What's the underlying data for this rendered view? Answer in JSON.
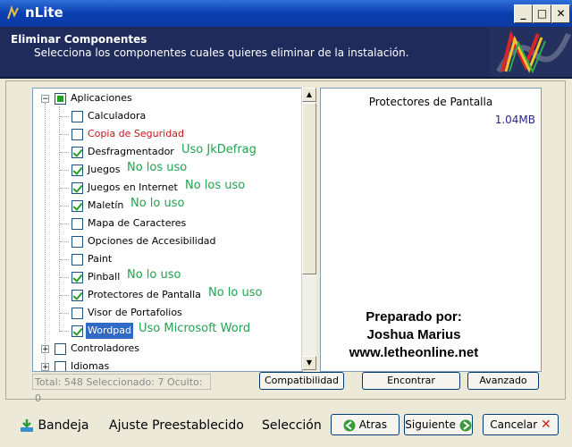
{
  "window": {
    "title": "nLite"
  },
  "header": {
    "title": "Eliminar Componentes",
    "subtitle": "Selecciona los componentes cuales quieres eliminar de la instalación."
  },
  "tree": {
    "root": {
      "label": "Aplicaciones",
      "state": "partial"
    },
    "items": [
      {
        "label": "Calculadora",
        "checked": false,
        "color": "#000000",
        "note": ""
      },
      {
        "label": "Copia de Seguridad",
        "checked": false,
        "color": "#c4161c",
        "note": ""
      },
      {
        "label": "Desfragmentador",
        "checked": true,
        "color": "#000000",
        "note": "Uso JkDefrag"
      },
      {
        "label": "Juegos",
        "checked": true,
        "color": "#000000",
        "note": "No los uso"
      },
      {
        "label": "Juegos en Internet",
        "checked": true,
        "color": "#000000",
        "note": "No los uso"
      },
      {
        "label": "Maletín",
        "checked": true,
        "color": "#000000",
        "note": "No lo uso"
      },
      {
        "label": "Mapa de Caracteres",
        "checked": false,
        "color": "#000000",
        "note": ""
      },
      {
        "label": "Opciones de Accesibilidad",
        "checked": false,
        "color": "#000000",
        "note": ""
      },
      {
        "label": "Paint",
        "checked": false,
        "color": "#000000",
        "note": ""
      },
      {
        "label": "Pinball",
        "checked": true,
        "color": "#000000",
        "note": "No lo uso"
      },
      {
        "label": "Protectores de Pantalla",
        "checked": true,
        "color": "#000000",
        "note": "No lo uso"
      },
      {
        "label": "Visor de Portafolios",
        "checked": false,
        "color": "#000000",
        "note": ""
      },
      {
        "label": "Wordpad",
        "checked": true,
        "color": "#000000",
        "note": "Uso Microsoft Word",
        "selected": true
      }
    ],
    "groups": [
      {
        "label": "Controladores"
      },
      {
        "label": "Idiomas"
      }
    ]
  },
  "info": {
    "title": "Protectores de Pantalla",
    "size": "1.04MB",
    "prepared_lines": [
      "Preparado por:",
      "Joshua Marius",
      "www.letheonline.net"
    ]
  },
  "status": "Total: 548 Seleccionado: 7 Oculto: 0",
  "buttons": {
    "compat": "Compatibilidad",
    "find": "Encontrar",
    "advanced": "Avanzado"
  },
  "footer": {
    "tray": "Bandeja",
    "preset": "Ajuste Preestablecido",
    "selection": "Selección",
    "back": "Atras",
    "next": "Siguiente",
    "cancel": "Cancelar"
  },
  "colors": {
    "accent": "#21a34e",
    "header_bg": "#1f2c5b",
    "selected_bg": "#316ac5"
  }
}
